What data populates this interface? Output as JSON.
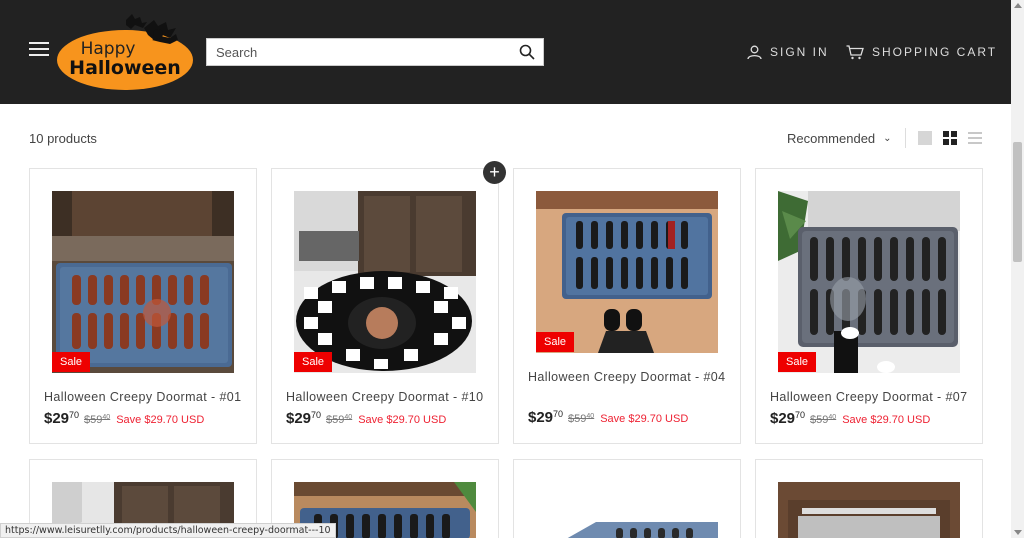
{
  "header": {
    "logo": {
      "line1": "Happy",
      "line2": "Halloween"
    },
    "search": {
      "placeholder": "Search"
    },
    "sign_in": "SIGN IN",
    "cart": "SHOPPING CART"
  },
  "toolbar": {
    "count": "10 products",
    "sort": "Recommended"
  },
  "products": [
    {
      "title": "Halloween Creepy Doormat - #01",
      "price_int": "$29",
      "price_dec": "70",
      "compare_int": "$59",
      "compare_dec": "40",
      "save": "Save $29.70 USD",
      "badge": "Sale"
    },
    {
      "title": "Halloween Creepy Doormat - #10",
      "price_int": "$29",
      "price_dec": "70",
      "compare_int": "$59",
      "compare_dec": "40",
      "save": "Save $29.70 USD",
      "badge": "Sale"
    },
    {
      "title": "Halloween Creepy Doormat - #04",
      "price_int": "$29",
      "price_dec": "70",
      "compare_int": "$59",
      "compare_dec": "40",
      "save": "Save $29.70 USD",
      "badge": "Sale"
    },
    {
      "title": "Halloween Creepy Doormat - #07",
      "price_int": "$29",
      "price_dec": "70",
      "compare_int": "$59",
      "compare_dec": "40",
      "save": "Save $29.70 USD",
      "badge": "Sale"
    }
  ],
  "quick_add_symbol": "+",
  "status_url": "https://www.leisuretlly.com/products/halloween-creepy-doormat---10",
  "colors": {
    "header_bg": "#222222",
    "sale": "#ee0000",
    "save_text": "#e22233",
    "logo_orange": "#f7941d"
  }
}
